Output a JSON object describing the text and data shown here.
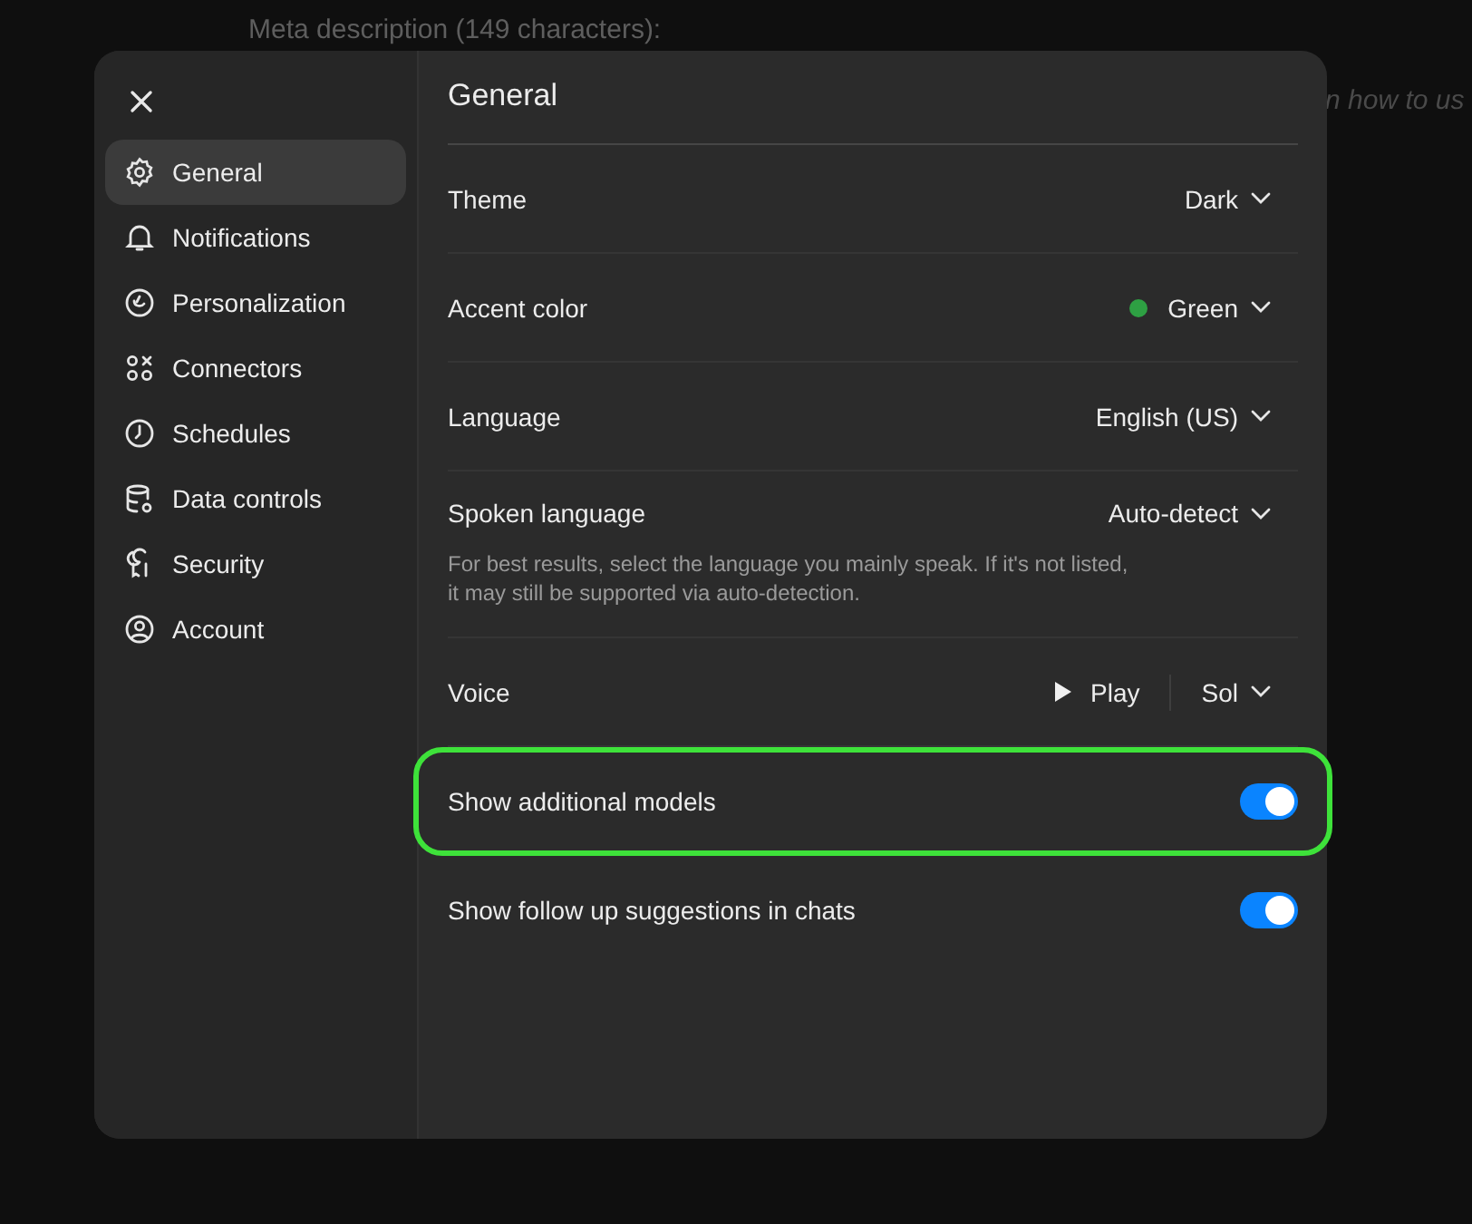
{
  "background": {
    "heading": "Meta description (149 characters):",
    "fragment": "n how to us"
  },
  "sidebar": {
    "items": [
      {
        "label": "General",
        "selected": true
      },
      {
        "label": "Notifications",
        "selected": false
      },
      {
        "label": "Personalization",
        "selected": false
      },
      {
        "label": "Connectors",
        "selected": false
      },
      {
        "label": "Schedules",
        "selected": false
      },
      {
        "label": "Data controls",
        "selected": false
      },
      {
        "label": "Security",
        "selected": false
      },
      {
        "label": "Account",
        "selected": false
      }
    ]
  },
  "panel": {
    "title": "General",
    "settings": [
      {
        "kind": "dropdown",
        "label": "Theme",
        "value": "Dark"
      },
      {
        "kind": "dropdown",
        "label": "Accent color",
        "value": "Green",
        "color": "#2ea043"
      },
      {
        "kind": "dropdown",
        "label": "Language",
        "value": "English (US)"
      },
      {
        "kind": "dropdown",
        "label": "Spoken language",
        "value": "Auto-detect",
        "hint": "For best results, select the language you mainly speak. If it's not listed,\nit may still be supported via auto-detection."
      },
      {
        "kind": "voice",
        "label": "Voice",
        "play": "Play",
        "value": "Sol"
      },
      {
        "kind": "toggle",
        "label": "Show additional models",
        "on": true,
        "highlighted": true
      },
      {
        "kind": "toggle",
        "label": "Show follow up suggestions in chats",
        "on": true,
        "highlighted": false
      }
    ]
  }
}
